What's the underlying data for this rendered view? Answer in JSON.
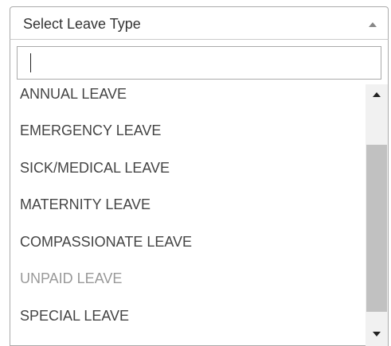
{
  "select": {
    "placeholder": "Select Leave Type",
    "arrow_icon": "chevron-up-icon"
  },
  "search": {
    "value": "",
    "placeholder": ""
  },
  "options": [
    {
      "label": "ANNUAL LEAVE",
      "disabled": false
    },
    {
      "label": "EMERGENCY LEAVE",
      "disabled": false
    },
    {
      "label": "SICK/MEDICAL LEAVE",
      "disabled": false
    },
    {
      "label": "MATERNITY LEAVE",
      "disabled": false
    },
    {
      "label": "COMPASSIONATE LEAVE",
      "disabled": false
    },
    {
      "label": "UNPAID LEAVE",
      "disabled": true
    },
    {
      "label": "SPECIAL LEAVE",
      "disabled": false
    }
  ],
  "scrollbar": {
    "up_icon": "scroll-up-arrow-icon",
    "down_icon": "scroll-down-arrow-icon"
  },
  "colors": {
    "text": "#444444",
    "disabled_text": "#999999",
    "border": "#aaaaaa",
    "scroll_track": "#f1f1f1",
    "scroll_thumb": "#c1c1c1"
  }
}
